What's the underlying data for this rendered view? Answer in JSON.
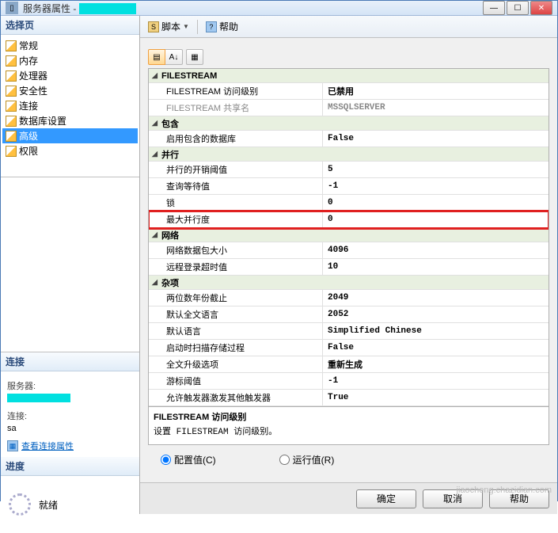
{
  "window": {
    "title_prefix": "服务器属性 - "
  },
  "toolbar": {
    "script": "脚本",
    "help": "帮助"
  },
  "sidebar": {
    "select_page": "选择页",
    "items": [
      {
        "label": "常规"
      },
      {
        "label": "内存"
      },
      {
        "label": "处理器"
      },
      {
        "label": "安全性"
      },
      {
        "label": "连接"
      },
      {
        "label": "数据库设置"
      },
      {
        "label": "高级"
      },
      {
        "label": "权限"
      }
    ],
    "selected_index": 6
  },
  "connection": {
    "header": "连接",
    "server_label": "服务器:",
    "conn_label": "连接:",
    "conn_value": "sa",
    "view_link": "查看连接属性"
  },
  "progress": {
    "header": "进度",
    "status": "就绪"
  },
  "grid": {
    "categories": [
      {
        "name": "FILESTREAM",
        "rows": [
          {
            "name": "FILESTREAM 访问级别",
            "value": "已禁用"
          },
          {
            "name": "FILESTREAM 共享名",
            "value": "MSSQLSERVER",
            "disabled": true
          }
        ]
      },
      {
        "name": "包含",
        "rows": [
          {
            "name": "启用包含的数据库",
            "value": "False"
          }
        ]
      },
      {
        "name": "并行",
        "rows": [
          {
            "name": "并行的开销阈值",
            "value": "5"
          },
          {
            "name": "查询等待值",
            "value": "-1"
          },
          {
            "name": "锁",
            "value": "0"
          },
          {
            "name": "最大并行度",
            "value": "0",
            "highlighted": true
          }
        ]
      },
      {
        "name": "网络",
        "rows": [
          {
            "name": "网络数据包大小",
            "value": "4096"
          },
          {
            "name": "远程登录超时值",
            "value": "10"
          }
        ]
      },
      {
        "name": "杂项",
        "rows": [
          {
            "name": "两位数年份截止",
            "value": "2049"
          },
          {
            "name": "默认全文语言",
            "value": "2052"
          },
          {
            "name": "默认语言",
            "value": "Simplified Chinese"
          },
          {
            "name": "启动时扫描存储过程",
            "value": "False"
          },
          {
            "name": "全文升级选项",
            "value": "重新生成"
          },
          {
            "name": "游标阈值",
            "value": "-1"
          },
          {
            "name": "允许触发器激发其他触发器",
            "value": "True"
          }
        ]
      }
    ]
  },
  "description": {
    "title": "FILESTREAM 访问级别",
    "text": "设置 FILESTREAM 访问级别。"
  },
  "radios": {
    "configured": "配置值(C)",
    "running": "运行值(R)"
  },
  "buttons": {
    "ok": "确定",
    "cancel": "取消",
    "help": "帮助"
  },
  "watermark": "jiaocheng.chazidian.com"
}
